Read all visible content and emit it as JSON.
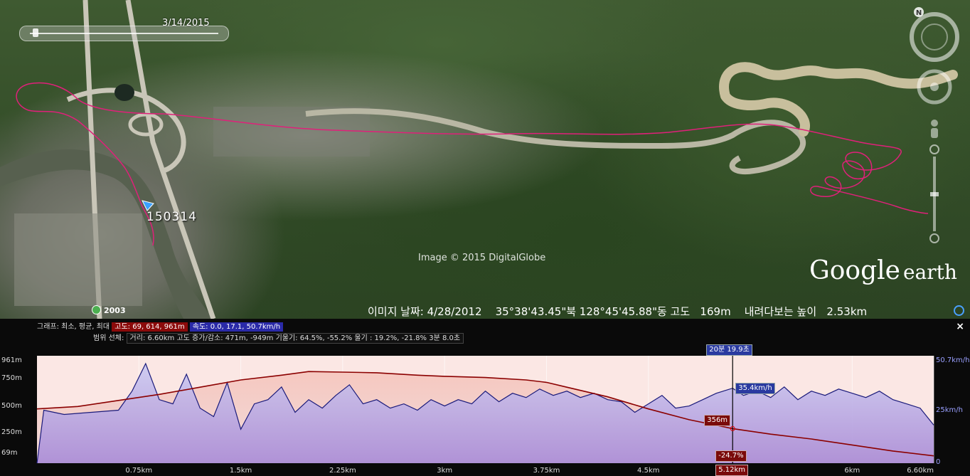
{
  "map": {
    "date_label": "3/14/2015",
    "track_label": "150314",
    "copyright": "Image © 2015 DigitalGlobe",
    "logo_google": "Google",
    "logo_earth": "earth",
    "historical_year": "2003",
    "status": "이미지 날짜: 4/28/2012    35°38'43.45\"북 128°45'45.88\"동 고도   169m    내려다보는 높이   2.53km",
    "compass_letter": "N",
    "track_color": "#e0207a"
  },
  "profile": {
    "line1_prefix": "그래프: 최소, 평균, 최대",
    "elev_box": "고도: 69, 614, 961m",
    "speed_box": "속도: 0.0, 17.1, 50.7km/h",
    "line2_prefix": "범위 선체:",
    "stats_box": "거리: 6.60km 고도 증가/감소: 471m, -949m 기울기: 64.5%, -55.2% 울기 : 19.2%, -21.8% 3분 8.0초",
    "y_left": [
      "961m",
      "750m",
      "500m",
      "250m",
      "69m"
    ],
    "y_right": [
      "50.7km/h",
      "25km/h",
      "0"
    ],
    "x_ticks": [
      "0.75km",
      "1.5km",
      "2.25km",
      "3km",
      "3.75km",
      "4.5km",
      "6km",
      "6.60km"
    ],
    "cursor": {
      "time": "20분 19.9초",
      "speed": "35.4km/h",
      "elevation": "356m",
      "grade": "-24.7%",
      "distance": "5.12km",
      "position_km": 5.12
    },
    "elevation_color": "#8b0000",
    "speed_color": "#1a1a7a",
    "close_label": "×"
  },
  "chart_data": {
    "type": "line",
    "xlabel": "",
    "ylabel": "",
    "xlim": [
      0,
      6.6
    ],
    "ylim_left": [
      69,
      961
    ],
    "ylim_right": [
      0,
      50.7
    ],
    "series": [
      {
        "name": "고도",
        "axis": "left",
        "unit": "m",
        "x": [
          0,
          0.3,
          0.6,
          0.9,
          1.2,
          1.5,
          1.8,
          2.0,
          2.25,
          2.5,
          2.8,
          3.0,
          3.3,
          3.6,
          3.75,
          3.9,
          4.2,
          4.5,
          4.8,
          5.12,
          5.4,
          5.7,
          6.0,
          6.3,
          6.6
        ],
        "values": [
          520,
          540,
          590,
          640,
          700,
          760,
          800,
          830,
          825,
          820,
          800,
          790,
          780,
          760,
          740,
          700,
          620,
          520,
          430,
          356,
          310,
          270,
          220,
          170,
          130
        ]
      },
      {
        "name": "속도",
        "axis": "right",
        "unit": "km/h",
        "x": [
          0,
          0.05,
          0.2,
          0.4,
          0.6,
          0.7,
          0.8,
          0.9,
          1.0,
          1.1,
          1.2,
          1.3,
          1.4,
          1.5,
          1.6,
          1.7,
          1.8,
          1.9,
          2.0,
          2.1,
          2.2,
          2.3,
          2.4,
          2.5,
          2.6,
          2.7,
          2.8,
          2.9,
          3.0,
          3.1,
          3.2,
          3.3,
          3.4,
          3.5,
          3.6,
          3.7,
          3.8,
          3.9,
          4.0,
          4.1,
          4.2,
          4.3,
          4.4,
          4.5,
          4.6,
          4.7,
          4.8,
          4.9,
          5.0,
          5.12,
          5.2,
          5.3,
          5.4,
          5.5,
          5.6,
          5.7,
          5.8,
          5.9,
          6.0,
          6.1,
          6.2,
          6.3,
          6.4,
          6.5,
          6.6
        ],
        "values": [
          0,
          25,
          23,
          24,
          25,
          34,
          47,
          30,
          28,
          42,
          26,
          22,
          38,
          16,
          28,
          30,
          36,
          24,
          30,
          26,
          32,
          37,
          28,
          30,
          26,
          28,
          25,
          30,
          27,
          30,
          28,
          34,
          29,
          33,
          31,
          35,
          32,
          34,
          31,
          33,
          30,
          29,
          24,
          28,
          32,
          26,
          27,
          30,
          33,
          35.4,
          32,
          34,
          31,
          36,
          30,
          34,
          32,
          35,
          33,
          31,
          34,
          30,
          28,
          26,
          18
        ]
      }
    ]
  }
}
